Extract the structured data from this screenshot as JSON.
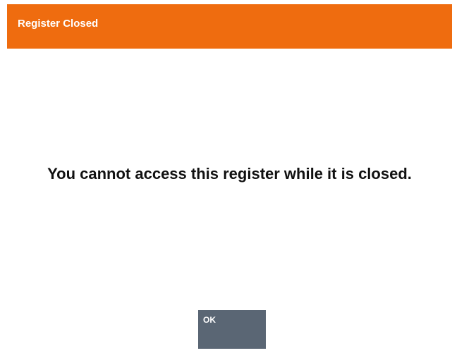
{
  "dialog": {
    "title": "Register Closed",
    "message": "You cannot access this register while it is closed.",
    "ok_label": "OK"
  },
  "colors": {
    "header_background": "#ef6c0f",
    "header_text": "#ffffff",
    "body_background": "#ffffff",
    "message_text": "#111111",
    "button_background": "#5a6674",
    "button_text": "#ffffff"
  }
}
